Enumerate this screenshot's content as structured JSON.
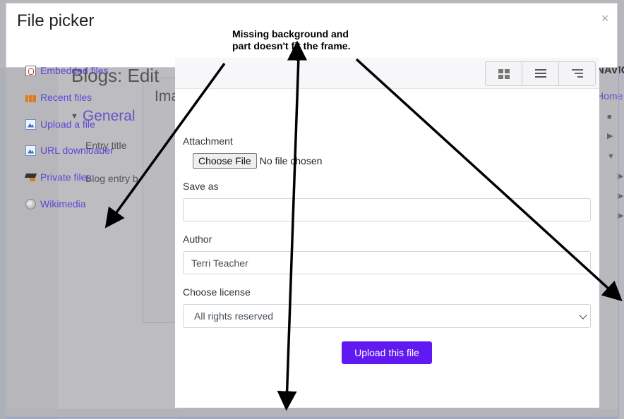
{
  "dialog": {
    "title": "File picker",
    "close_glyph": "×"
  },
  "repositories": [
    {
      "label": "Embedded files",
      "icon": "embedded-files-icon"
    },
    {
      "label": "Recent files",
      "icon": "recent-files-icon"
    },
    {
      "label": "Upload a file",
      "icon": "upload-file-icon"
    },
    {
      "label": "URL downloader",
      "icon": "url-downloader-icon"
    },
    {
      "label": "Private files",
      "icon": "private-files-icon"
    },
    {
      "label": "Wikimedia",
      "icon": "wikimedia-icon"
    }
  ],
  "background": {
    "page_title": "Blogs: Edit",
    "general_heading": "General",
    "image_heading": "Ima",
    "entry_title_label": "Entry title",
    "blog_entry_label": "Blog entry b",
    "nav_title": "NAVIG",
    "nav_home": "Home"
  },
  "toolbar": {
    "views": [
      {
        "name": "icons-view",
        "icon": "grid-icon"
      },
      {
        "name": "details-view",
        "icon": "list-icon"
      },
      {
        "name": "tree-view",
        "icon": "tree-list-icon"
      }
    ]
  },
  "form": {
    "attachment_label": "Attachment",
    "choose_file_label": "Choose File",
    "no_file_text": "No file chosen",
    "save_as_label": "Save as",
    "save_as_value": "",
    "author_label": "Author",
    "author_value": "Terri Teacher",
    "license_label": "Choose license",
    "license_value": "All rights reserved",
    "upload_button_label": "Upload this file"
  },
  "annotation": {
    "text": "Missing background and part doesn't fit the frame."
  },
  "colors": {
    "accent": "#6019f0",
    "link": "#5b47d6",
    "overlay_background": "#b9b9bd"
  }
}
